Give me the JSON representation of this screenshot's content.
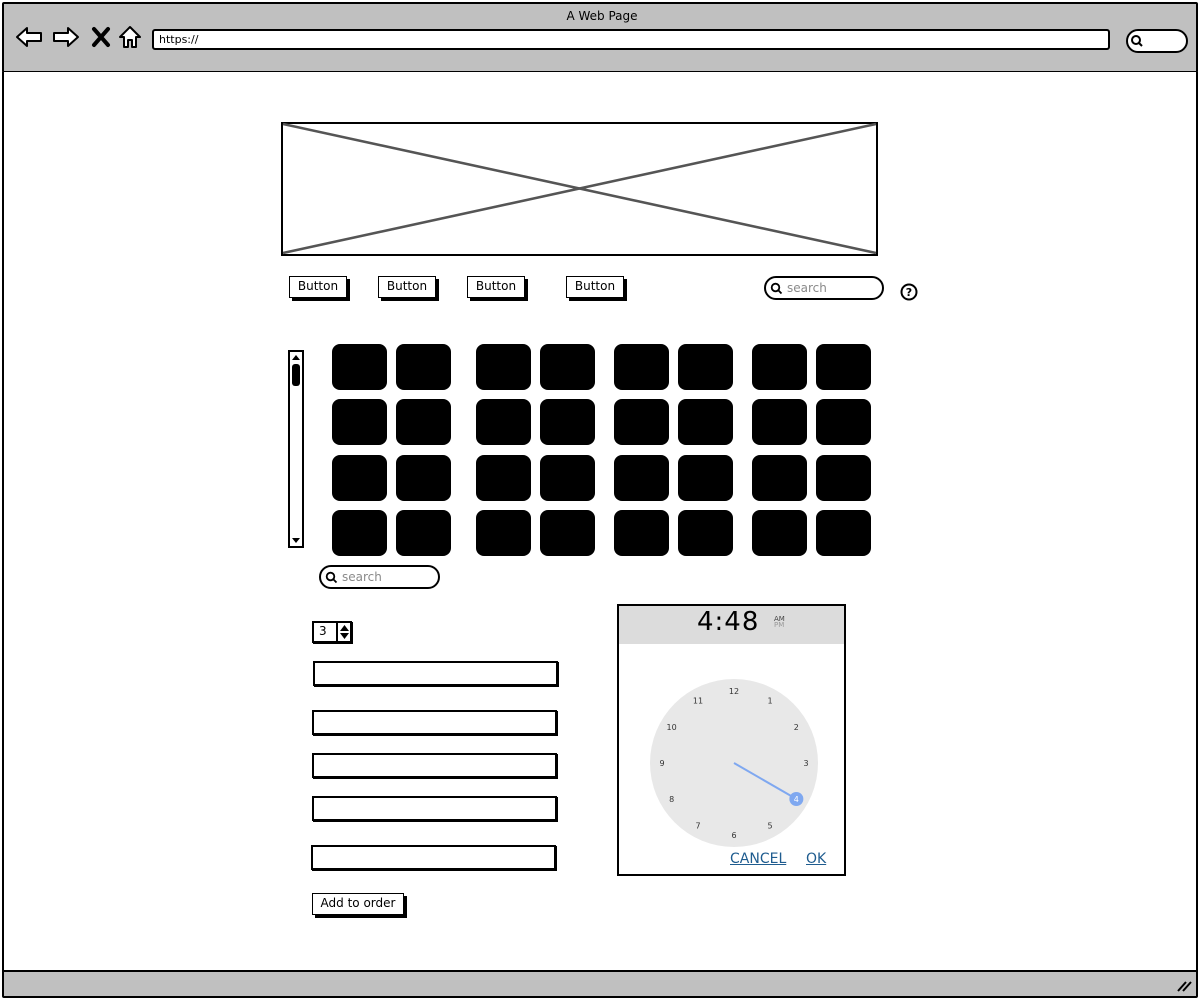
{
  "window": {
    "title": "A Web Page",
    "url": "https://"
  },
  "toolbar": {
    "buttons": [
      "Button",
      "Button",
      "Button",
      "Button"
    ],
    "search_placeholder": "search"
  },
  "grid": {
    "search_placeholder": "search"
  },
  "form": {
    "quantity": "3",
    "fields": [
      "",
      "",
      "",
      "",
      ""
    ],
    "submit_label": "Add to order"
  },
  "time_picker": {
    "time": "4:48",
    "am_label": "AM",
    "pm_label": "PM",
    "selected_hour": 4,
    "hour_labels": [
      "12",
      "1",
      "2",
      "3",
      "4",
      "5",
      "6",
      "7",
      "8",
      "9",
      "10",
      "11"
    ],
    "cancel_label": "CANCEL",
    "ok_label": "OK",
    "accent_color": "#7fa8f0"
  }
}
